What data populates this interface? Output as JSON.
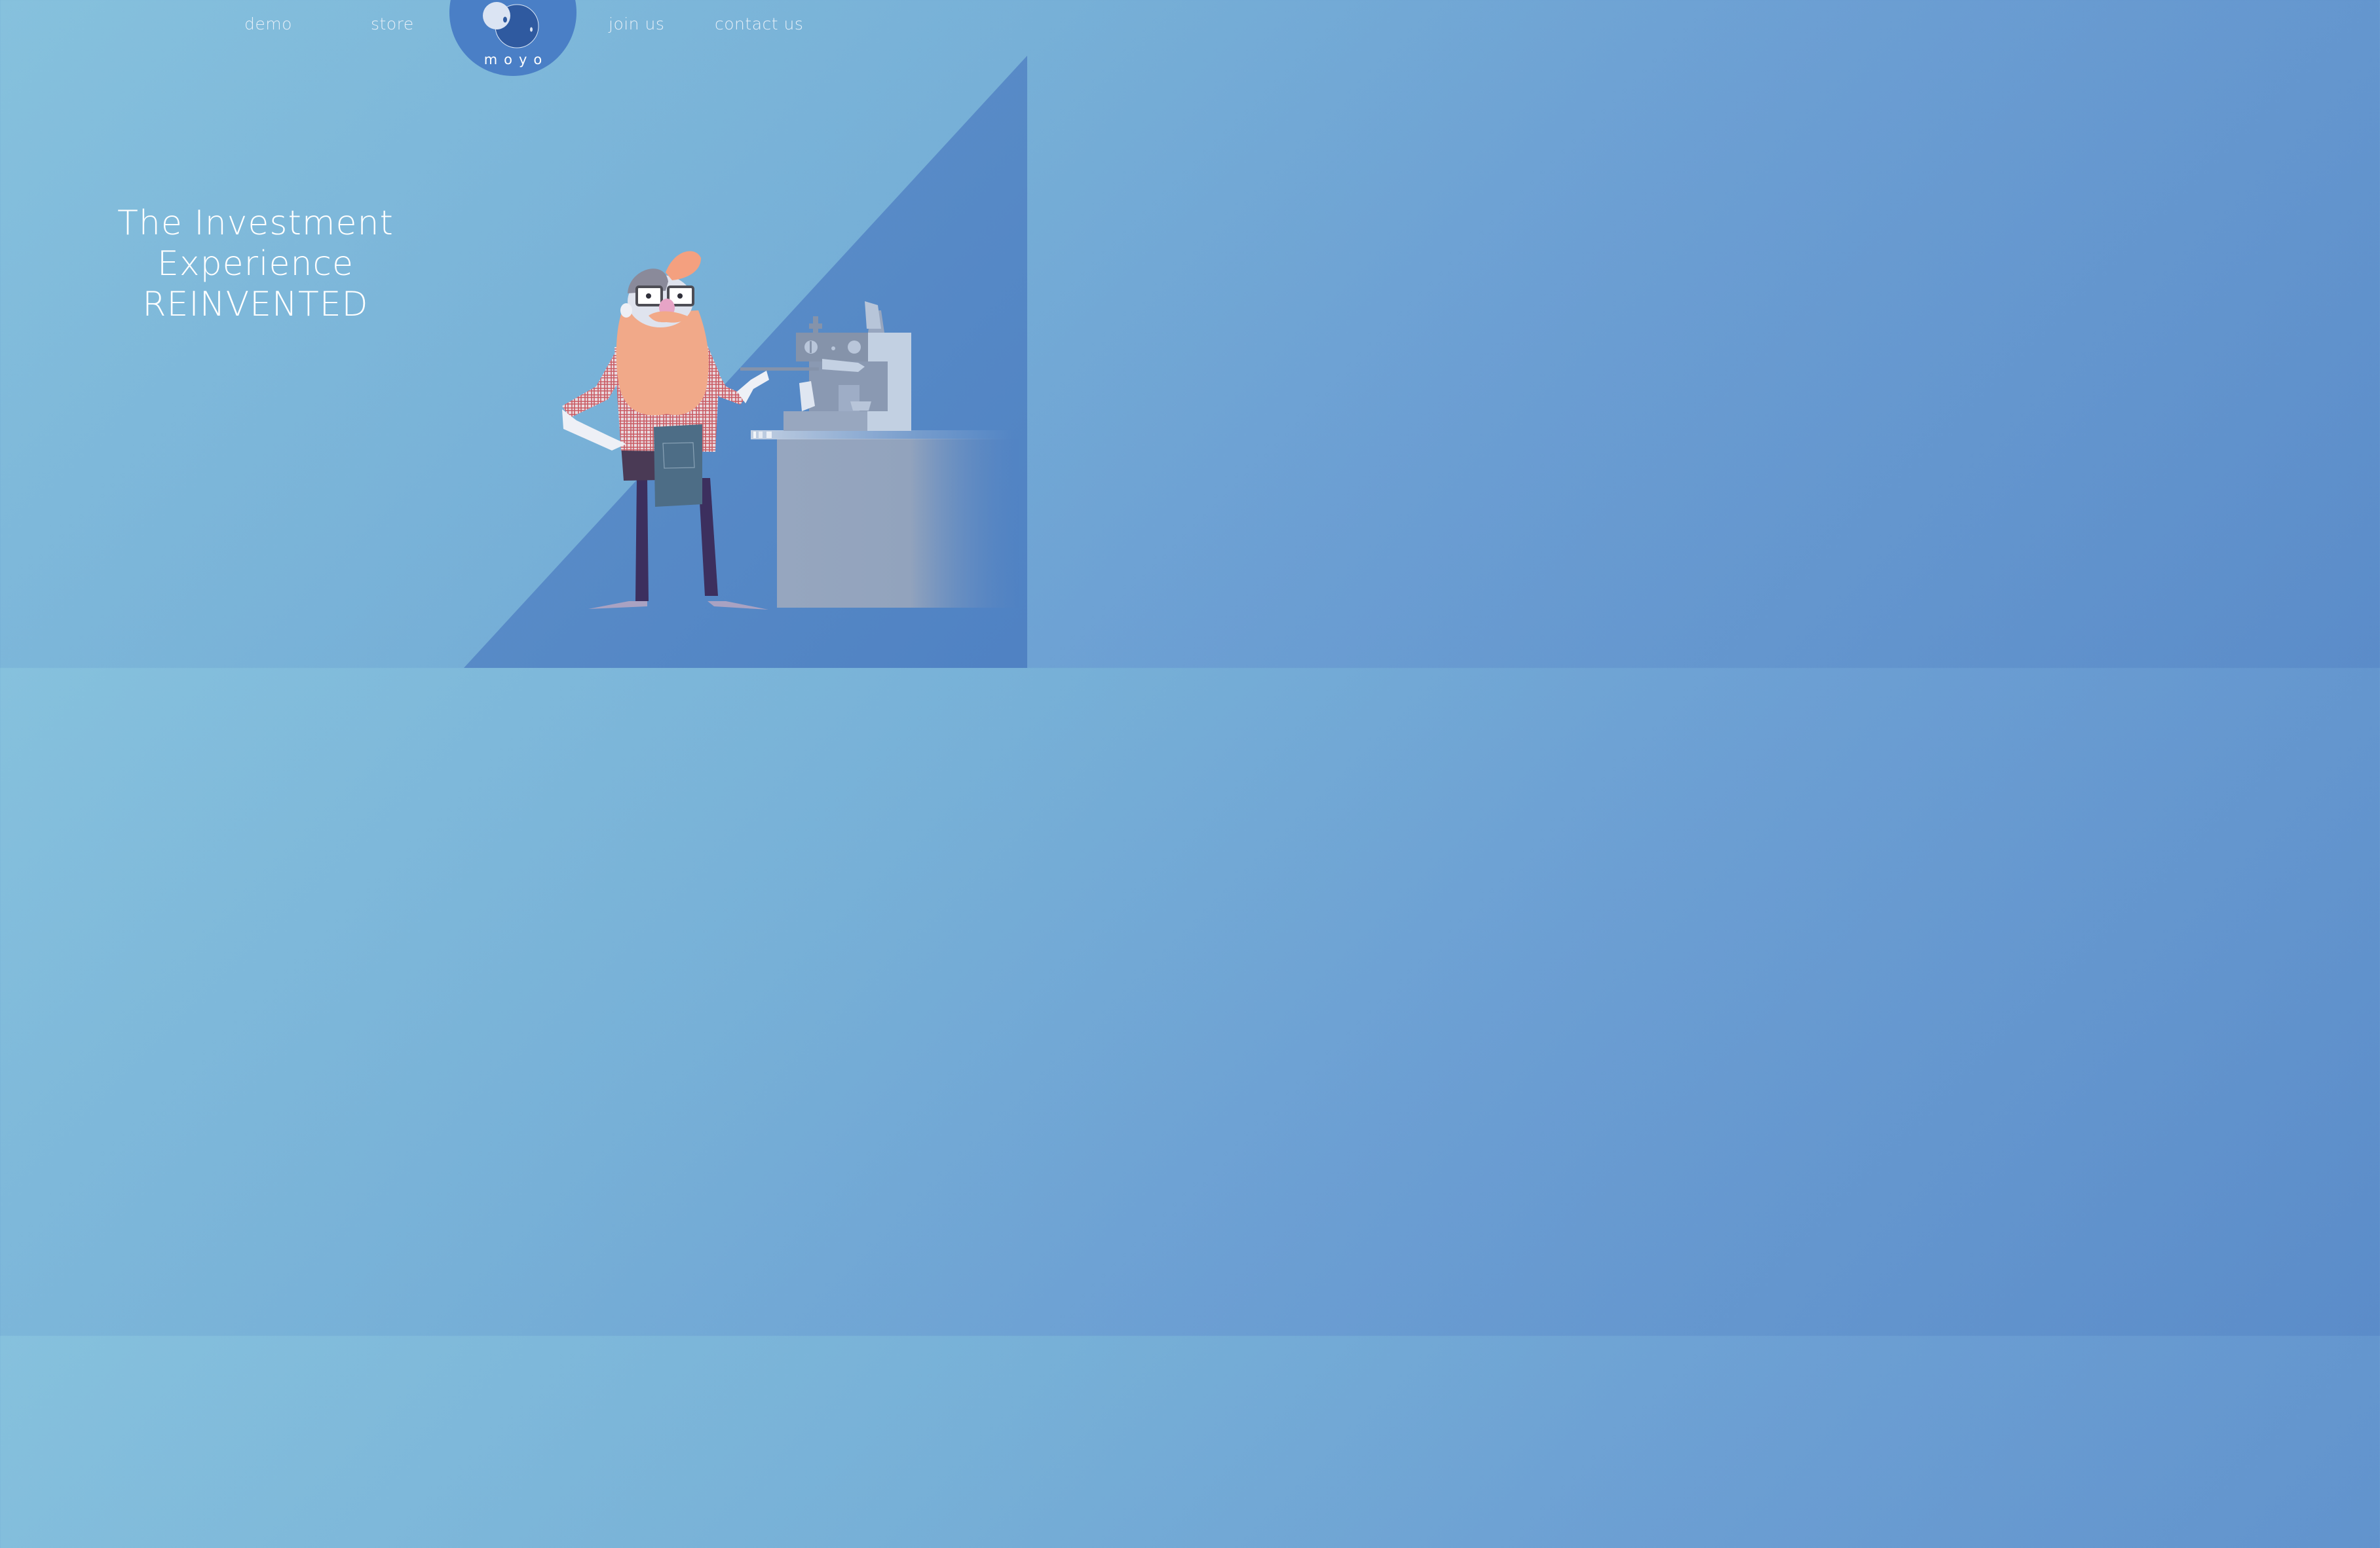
{
  "nav": {
    "left": [
      {
        "label": "demo"
      },
      {
        "label": "store"
      }
    ],
    "right": [
      {
        "label": "join us"
      },
      {
        "label": "contact us"
      }
    ]
  },
  "logo": {
    "wordmark": "moyo",
    "color": "#4a7fc6"
  },
  "hero": {
    "lines": [
      "The Investment",
      "Experience",
      "REINVENTED"
    ]
  },
  "illustration": {
    "subject": "bearded-barista-with-espresso-machine"
  },
  "colors": {
    "background_light": "#86c1dd",
    "background_dark": "#5b8cc9",
    "diagonal_panel": "#4f80c2",
    "text": "#ffffff"
  }
}
